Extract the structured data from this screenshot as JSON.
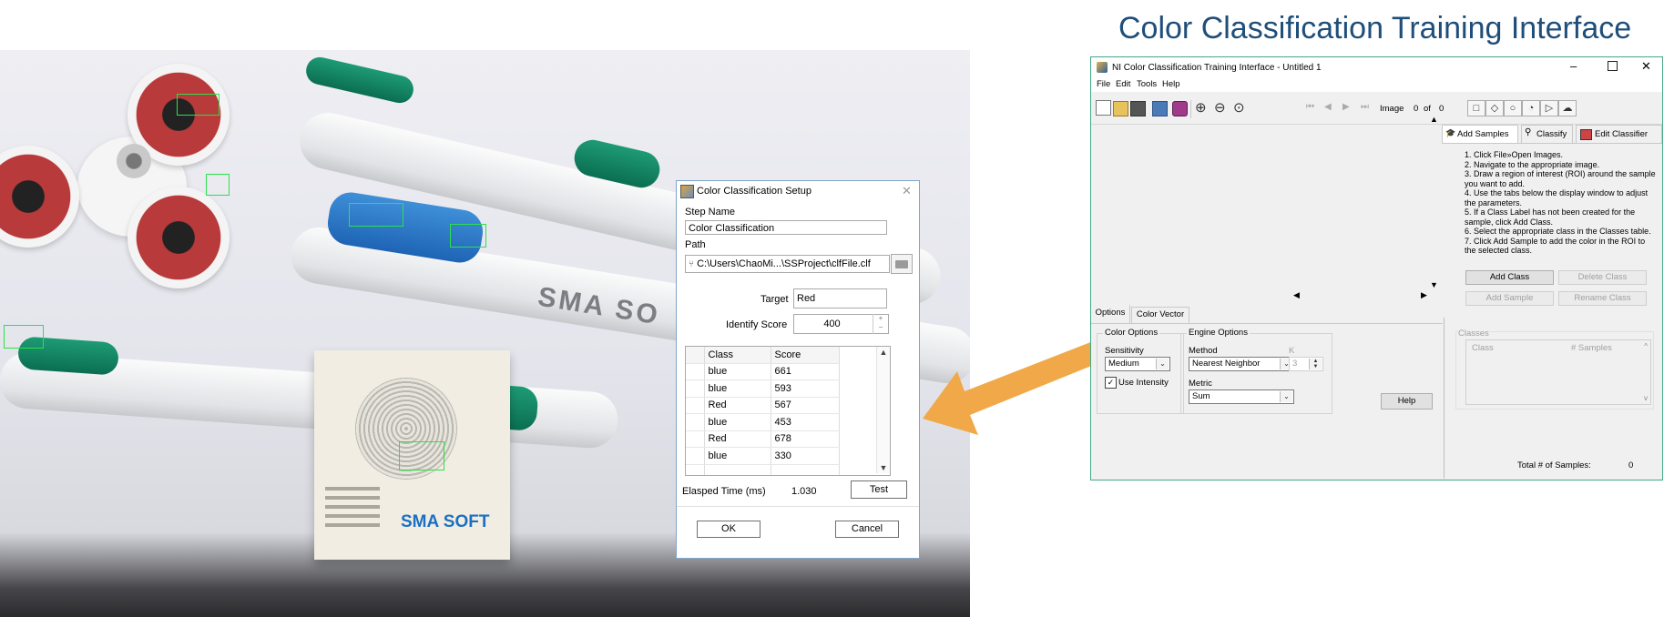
{
  "page_title": "Color Classification Training Interface",
  "setup_dialog": {
    "title": "Color Classification Setup",
    "step_name_label": "Step Name",
    "step_name_value": "Color Classification",
    "path_label": "Path",
    "path_value": "C:\\Users\\ChaoMi...\\SSProject\\clfFile.clf",
    "target_label": "Target",
    "target_value": "Red",
    "identify_score_label": "Identify Score",
    "identify_score_value": "400",
    "table": {
      "columns": [
        "Class",
        "Score"
      ],
      "rows": [
        {
          "class": "blue",
          "score": "661"
        },
        {
          "class": "blue",
          "score": "593"
        },
        {
          "class": "Red",
          "score": "567"
        },
        {
          "class": "blue",
          "score": "453"
        },
        {
          "class": "Red",
          "score": "678"
        },
        {
          "class": "blue",
          "score": "330"
        }
      ]
    },
    "elapsed_label": "Elasped Time (ms)",
    "elapsed_value": "1.030",
    "test_label": "Test",
    "ok_label": "OK",
    "cancel_label": "Cancel"
  },
  "photo_text": {
    "brand_upper": "SMA SO",
    "brand_card": "SMA SOFT"
  },
  "ni_window": {
    "title": "NI Color Classification Training Interface - Untitled 1",
    "menu": [
      "File",
      "Edit",
      "Tools",
      "Help"
    ],
    "image_label": "Image",
    "image_index": "0",
    "image_of": "of",
    "image_total": "0",
    "tabs": [
      "Add Samples",
      "Classify",
      "Edit Classifier"
    ],
    "instructions": [
      "1. Click File»Open Images.",
      "2. Navigate to the appropriate image.",
      "3. Draw a region of interest (ROI) around the sample you want to add.",
      "4. Use the tabs below the display window to adjust the parameters.",
      "5. If a Class Label has not been created for the sample, click Add Class.",
      "6. Select the appropriate class in the Classes table.",
      "7. Click Add Sample to add the color in the ROI to the selected class."
    ],
    "add_class": "Add Class",
    "delete_class": "Delete Class",
    "add_sample": "Add Sample",
    "rename_class": "Rename Class",
    "bottom_tabs": [
      "Options",
      "Color Vector"
    ],
    "color_options_title": "Color Options",
    "sensitivity_label": "Sensitivity",
    "sensitivity_value": "Medium",
    "use_intensity_label": "Use Intensity",
    "engine_options_title": "Engine Options",
    "method_label": "Method",
    "method_value": "Nearest Neighbor",
    "k_label": "K",
    "k_value": "3",
    "metric_label": "Metric",
    "metric_value": "Sum",
    "help_label": "Help",
    "classes_title": "Classes",
    "classes_columns": [
      "Class",
      "# Samples"
    ],
    "total_samples_label": "Total # of Samples:",
    "total_samples_value": "0"
  },
  "colors": {
    "title_blue": "#1f4e79",
    "arrow": "#f0a848",
    "roi_green": "#2de04a",
    "window_border": "#45a886"
  }
}
